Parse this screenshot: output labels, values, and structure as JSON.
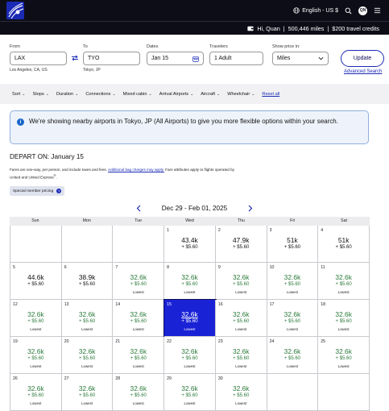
{
  "header": {
    "language": "English - US $",
    "avatar_initials": "QN"
  },
  "member": {
    "greeting": "Hi, Quan",
    "miles": "500,446 miles",
    "credits": "$200 travel credits"
  },
  "search": {
    "from_label": "From",
    "from_value": "LAX",
    "from_sub": "Los Angeles, CA, US",
    "to_label": "To",
    "to_value": "TYO",
    "to_sub": "Tokyo, JP",
    "dates_label": "Dates",
    "dates_value": "Jan 15",
    "travelers_label": "Travelers",
    "travelers_value": "1 Adult",
    "price_label": "Show price in:",
    "price_value": "Miles",
    "update_label": "Update",
    "advanced_label": "Advanced Search"
  },
  "filters": [
    "Sort",
    "Stops",
    "Duration",
    "Connections",
    "Mixed cabin",
    "Arrival Airports",
    "Aircraft",
    "Wheelchair"
  ],
  "reset_label": "Reset all",
  "notice": {
    "text": "We're showing nearby airports in Tokyo, JP (All Airports) to give you more flexible options within your search."
  },
  "depart": {
    "label": "DEPART ON: January 15"
  },
  "fares": {
    "text_before": "Fares are one-way, per person, and include taxes and fees.",
    "link": "Additional bag charges may apply.",
    "text_after": "Fare attributes apply to flights operated by United and United Express",
    "sup": "®",
    "end": "."
  },
  "special": {
    "label": "Special member pricing",
    "help": "?"
  },
  "calendar": {
    "range": "Dec 29 - Feb 01, 2025",
    "days_of_week": [
      "Sun",
      "Mon",
      "Tue",
      "Wed",
      "Thu",
      "Fri",
      "Sat"
    ],
    "cells": [
      {
        "day": "",
        "price": "",
        "tax": "",
        "note": ""
      },
      {
        "day": "",
        "price": "",
        "tax": "",
        "note": ""
      },
      {
        "day": "",
        "price": "",
        "tax": "",
        "note": ""
      },
      {
        "day": "1",
        "price": "43.4k",
        "tax": "+ $5.60",
        "note": ""
      },
      {
        "day": "2",
        "price": "47.9k",
        "tax": "+ $5.60",
        "note": ""
      },
      {
        "day": "3",
        "price": "51k",
        "tax": "+ $5.60",
        "note": ""
      },
      {
        "day": "4",
        "price": "51k",
        "tax": "+ $5.60",
        "note": ""
      },
      {
        "day": "5",
        "price": "44.6k",
        "tax": "+ $5.60",
        "note": ""
      },
      {
        "day": "6",
        "price": "38.9k",
        "tax": "+ $5.60",
        "note": ""
      },
      {
        "day": "7",
        "price": "32.6k",
        "tax": "+ $5.60",
        "note": "Lowest"
      },
      {
        "day": "8",
        "price": "32.6k",
        "tax": "+ $5.60",
        "note": "Lowest"
      },
      {
        "day": "9",
        "price": "32.6k",
        "tax": "+ $5.60",
        "note": "Lowest"
      },
      {
        "day": "10",
        "price": "32.6k",
        "tax": "+ $5.60",
        "note": "Lowest"
      },
      {
        "day": "11",
        "price": "32.6k",
        "tax": "+ $5.60",
        "note": "Lowest"
      },
      {
        "day": "12",
        "price": "32.6k",
        "tax": "+ $5.60",
        "note": "Lowest"
      },
      {
        "day": "13",
        "price": "32.6k",
        "tax": "+ $5.60",
        "note": "Lowest"
      },
      {
        "day": "14",
        "price": "32.6k",
        "tax": "+ $5.60",
        "note": "Lowest"
      },
      {
        "day": "15",
        "price": "32.6k",
        "tax": "+ $5.60",
        "note": "Lowest"
      },
      {
        "day": "16",
        "price": "32.6k",
        "tax": "+ $5.60",
        "note": "Lowest"
      },
      {
        "day": "17",
        "price": "32.6k",
        "tax": "+ $5.60",
        "note": "Lowest"
      },
      {
        "day": "18",
        "price": "32.6k",
        "tax": "+ $5.60",
        "note": "Lowest"
      },
      {
        "day": "19",
        "price": "32.6k",
        "tax": "+ $5.60",
        "note": "Lowest"
      },
      {
        "day": "20",
        "price": "32.6k",
        "tax": "+ $5.60",
        "note": "Lowest"
      },
      {
        "day": "21",
        "price": "32.6k",
        "tax": "+ $5.60",
        "note": "Lowest"
      },
      {
        "day": "22",
        "price": "32.6k",
        "tax": "+ $5.60",
        "note": "Lowest"
      },
      {
        "day": "23",
        "price": "32.6k",
        "tax": "+ $5.60",
        "note": "Lowest"
      },
      {
        "day": "24",
        "price": "32.6k",
        "tax": "+ $5.60",
        "note": "Lowest"
      },
      {
        "day": "25",
        "price": "32.6k",
        "tax": "+ $5.60",
        "note": "Lowest"
      },
      {
        "day": "26",
        "price": "32.6k",
        "tax": "+ $5.60",
        "note": "Lowest"
      },
      {
        "day": "27",
        "price": "32.6k",
        "tax": "+ $5.60",
        "note": "Lowest"
      },
      {
        "day": "28",
        "price": "32.6k",
        "tax": "+ $5.60",
        "note": "Lowest"
      },
      {
        "day": "29",
        "price": "32.6k",
        "tax": "+ $5.60",
        "note": "Lowest"
      },
      {
        "day": "30",
        "price": "32.6k",
        "tax": "+ $5.60",
        "note": "Lowest"
      },
      {
        "day": "",
        "price": "",
        "tax": "",
        "note": ""
      },
      {
        "day": "",
        "price": "",
        "tax": "",
        "note": ""
      }
    ],
    "selected_day": "15"
  },
  "colors": {
    "brand_dark": "#0d0d18",
    "brand_blue": "#1a2ab5",
    "selected_blue": "#1a22d6",
    "lowest_green": "#2a7a3a"
  }
}
